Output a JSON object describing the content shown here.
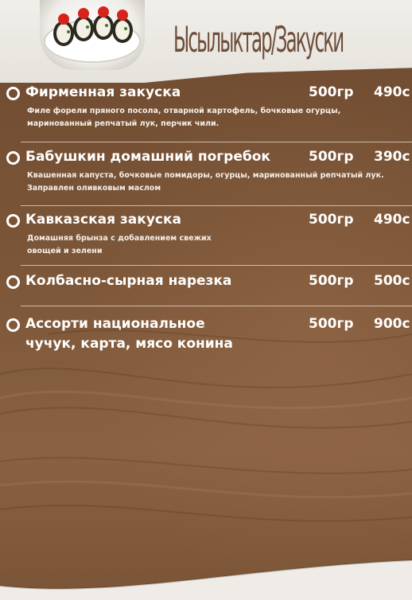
{
  "header": {
    "title": "Ысылыктар/Закуски"
  },
  "menu": {
    "items": [
      {
        "name": "Фирменная закуска",
        "description": "Филе форели пряного посола, отварной картофель, бочковые огурцы, маринованный репчатый лук, перчик чили.",
        "weight": "500гр",
        "price": "490с"
      },
      {
        "name": "Бабушкин домашний погребок",
        "description": "Квашенная капуста, бочковые помидоры, огурцы, маринованный репчатый лук. Заправлен оливковым маслом",
        "weight": "500гр",
        "price": "390с"
      },
      {
        "name": "Кавказская закуска",
        "description": "Домашняя брынза с добавлением свежих овощей и зелени",
        "weight": "500гр",
        "price": "490с"
      },
      {
        "name": "Колбасно-сырная нарезка",
        "description": "",
        "weight": "500гр",
        "price": "500с"
      },
      {
        "name": "Ассорти национальное",
        "name_line2": "чучук, карта, мясо конина",
        "description": "",
        "weight": "500гр",
        "price": "900с"
      }
    ]
  },
  "colors": {
    "background": "#7a5436",
    "header_band": "#eeebe6",
    "title": "#6d4e3a",
    "text": "#ffffff"
  }
}
